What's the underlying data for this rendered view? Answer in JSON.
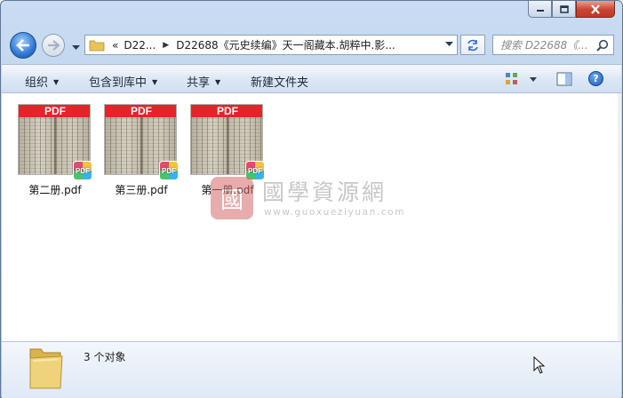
{
  "window": {
    "controls": {
      "minimize": "minimize",
      "maximize": "maximize",
      "close": "close"
    }
  },
  "nav": {
    "address_prefix": "«",
    "address_crumbs": [
      "D22...",
      "D22688《元史续编》天一阁藏本.胡粹中.影..."
    ],
    "search_placeholder": "搜索 D22688《...",
    "icons": {
      "back": "back-arrow-icon",
      "forward": "forward-arrow-icon",
      "refresh": "refresh-icon",
      "search": "magnifier-icon"
    }
  },
  "commandbar": {
    "organize": "组织",
    "include_in_library": "包含到库中",
    "share": "共享",
    "new_folder": "新建文件夹"
  },
  "files": [
    {
      "thumb_label": "PDF",
      "badge": "PDF",
      "name": "第二册.pdf"
    },
    {
      "thumb_label": "PDF",
      "badge": "PDF",
      "name": "第三册.pdf"
    },
    {
      "thumb_label": "PDF",
      "badge": "PDF",
      "name": "第一册.pdf"
    }
  ],
  "watermark": {
    "seal_char": "國",
    "title": "國學資源網",
    "url": "www.guoxueziyuan.com"
  },
  "details": {
    "count": "3 个对象"
  },
  "colors": {
    "pdf_red": "#e3242b",
    "frame_blue": "#b7cde9",
    "command_bar": "#dde8f5"
  }
}
